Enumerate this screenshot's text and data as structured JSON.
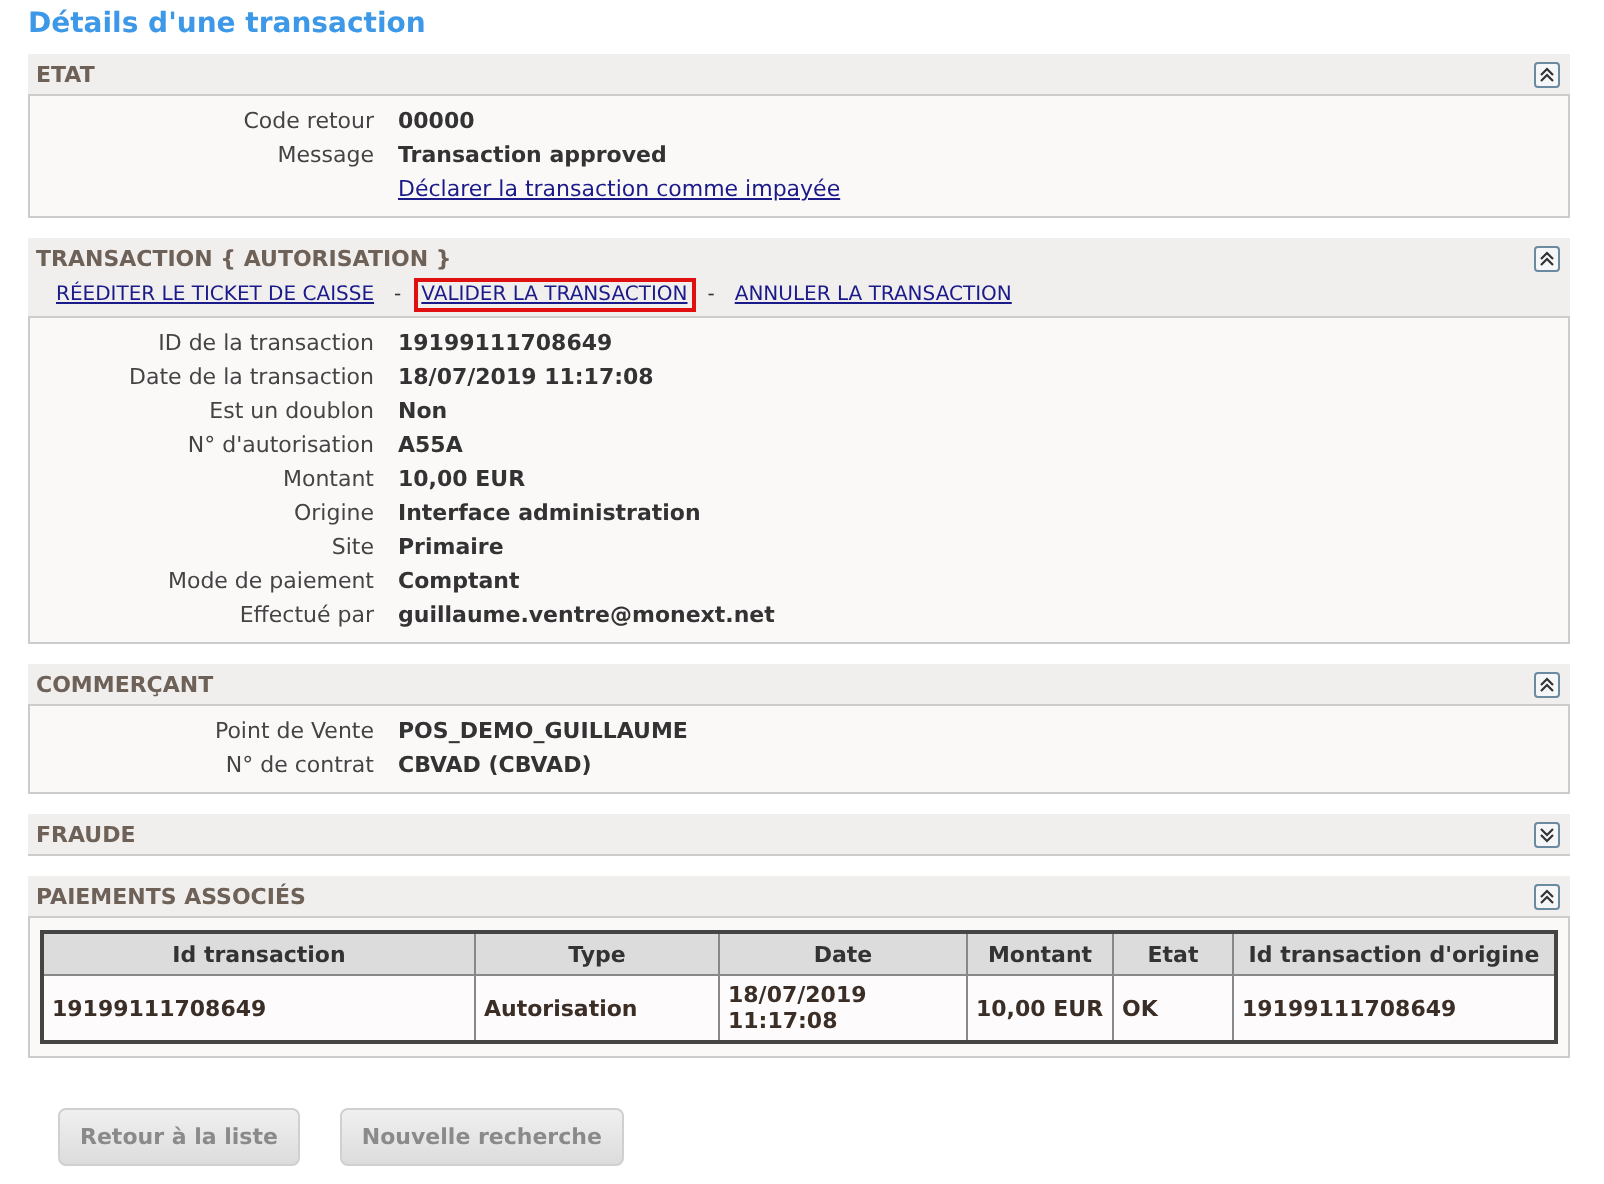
{
  "page_title": "Détails d'une transaction",
  "sections": [
    {
      "title": "ETAT",
      "expanded": true,
      "fields": [
        {
          "label": "Code retour",
          "value": "00000"
        },
        {
          "label": "Message",
          "value": "Transaction approved"
        }
      ],
      "body_links": [
        "Déclarer la transaction comme impayée"
      ]
    },
    {
      "title": "TRANSACTION { AUTORISATION }",
      "expanded": true,
      "actions": [
        {
          "label": "RÉEDITER LE TICKET DE CAISSE",
          "highlighted": false
        },
        {
          "label": "VALIDER LA TRANSACTION",
          "highlighted": true
        },
        {
          "label": "ANNULER LA TRANSACTION",
          "highlighted": false
        }
      ],
      "separators": [
        "-",
        "-"
      ],
      "fields": [
        {
          "label": "ID de la transaction",
          "value": "19199111708649"
        },
        {
          "label": "Date de la transaction",
          "value": "18/07/2019 11:17:08"
        },
        {
          "label": "Est un doublon",
          "value": "Non"
        },
        {
          "label": "N° d'autorisation",
          "value": "A55A"
        },
        {
          "label": "Montant",
          "value": "10,00 EUR"
        },
        {
          "label": "Origine",
          "value": "Interface administration"
        },
        {
          "label": "Site",
          "value": "Primaire"
        },
        {
          "label": "Mode de paiement",
          "value": "Comptant"
        },
        {
          "label": "Effectué par",
          "value": "guillaume.ventre@monext.net"
        }
      ]
    },
    {
      "title": "COMMERÇANT",
      "expanded": true,
      "fields": [
        {
          "label": "Point de Vente",
          "value": "POS_DEMO_GUILLAUME"
        },
        {
          "label": "N° de contrat",
          "value": "CBVAD (CBVAD)"
        }
      ]
    },
    {
      "title": "FRAUDE",
      "expanded": false
    },
    {
      "title": "PAIEMENTS ASSOCIÉS",
      "expanded": true,
      "table": {
        "columns": [
          "Id transaction",
          "Type",
          "Date",
          "Montant",
          "Etat",
          "Id transaction d'origine"
        ],
        "rows": [
          [
            "19199111708649",
            "Autorisation",
            "18/07/2019 11:17:08",
            "10,00 EUR",
            "OK",
            "19199111708649"
          ]
        ]
      }
    }
  ],
  "buttons": [
    "Retour à la liste",
    "Nouvelle recherche"
  ]
}
